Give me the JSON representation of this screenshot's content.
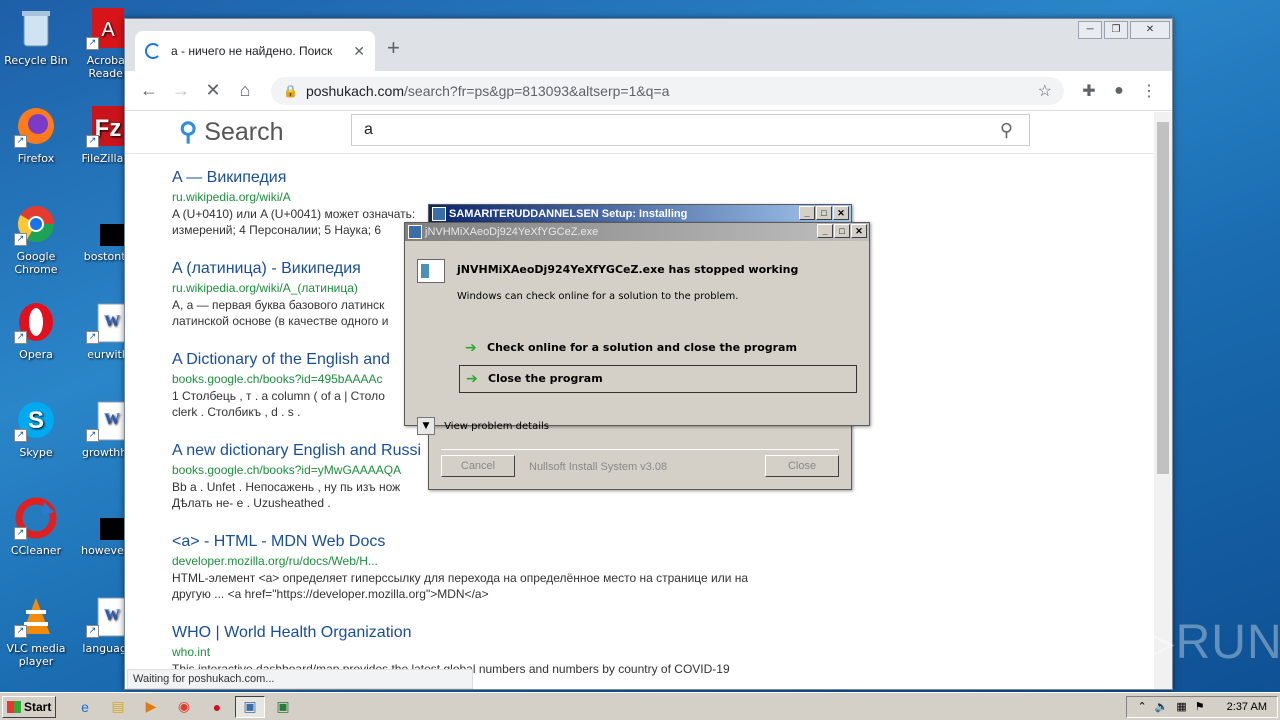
{
  "desktop_icons": [
    {
      "label": "Recycle Bin",
      "icon": "recycle-bin-icon"
    },
    {
      "label": "Acrobat Reader",
      "icon": "acrobat-icon"
    },
    {
      "label": "Firefox",
      "icon": "firefox-icon"
    },
    {
      "label": "FileZilla C",
      "icon": "filezilla-icon"
    },
    {
      "label": "Google Chrome",
      "icon": "chrome-icon"
    },
    {
      "label": "bostonto",
      "icon": "file-icon"
    },
    {
      "label": "Opera",
      "icon": "opera-icon"
    },
    {
      "label": "eurwith",
      "icon": "word-doc-icon"
    },
    {
      "label": "Skype",
      "icon": "skype-icon"
    },
    {
      "label": "growthho",
      "icon": "word-doc-icon"
    },
    {
      "label": "CCleaner",
      "icon": "ccleaner-icon"
    },
    {
      "label": "howevere",
      "icon": "file-icon"
    },
    {
      "label": "VLC media player",
      "icon": "vlc-icon"
    },
    {
      "label": "language",
      "icon": "word-doc-icon"
    }
  ],
  "browser": {
    "tab_title": "а - ничего не найдено. Поиск",
    "tab_close": "✕",
    "new_tab": "+",
    "url_host": "poshukach.com",
    "url_path": "/search?fr=ps&gp=813093&altserp=1&q=a",
    "window_controls": [
      "─",
      "❐",
      "✕"
    ],
    "status_text": "Waiting for poshukach.com..."
  },
  "site": {
    "logo": "Search",
    "query": "a"
  },
  "results": [
    {
      "title": "A — Википедия",
      "url": "ru.wikipedia.org/wiki/A",
      "snippet": "A (U+0410) или A (U+0041) может означать:",
      "snippet2": "измерений; 4 Персоналии; 5 Наука; 6"
    },
    {
      "title": "A (латиница) - Википедия",
      "url": "ru.wikipedia.org/wiki/A_(латиница)",
      "snippet": "A, a — первая буква базового латинск",
      "snippet2": "латинской основе (в качестве одного и"
    },
    {
      "title": "A Dictionary of the English and",
      "url": "books.google.ch/books?id=495bAAAAc",
      "snippet": "1 Столбець , т . a column ( of a | Столо",
      "snippet2": "clerk . Столбикъ , d . s ."
    },
    {
      "title": "A new dictionary English and Russi",
      "url": "books.google.ch/books?id=yMwGAAAAQA",
      "snippet": "Bb a . Unfet . Непосажень , ну пь изъ нож",
      "snippet2": "Дѣлать не- е . Uzusheathed ."
    },
    {
      "title": "<a> - HTML - MDN Web Docs",
      "url": "developer.mozilla.org/ru/docs/Web/H...",
      "snippet": "HTML-элемент <a> определяет гиперссылку для перехода на определённое место на странице или на",
      "snippet2": "другую ... <a href=\"https://developer.mozilla.org\">MDN</a>"
    },
    {
      "title": "WHO | World Health Organization",
      "url": "who.int",
      "snippet": "This interactive dashboard/map provides the latest global numbers and numbers by country of COVID-19",
      "snippet2": ""
    }
  ],
  "nsis": {
    "title": "SAMARITERUDDANNELSEN Setup: Installing",
    "cancel": "Cancel",
    "brand": "Nullsoft Install System v3.08",
    "close": "Close"
  },
  "werr": {
    "title": "jNVHMiXAeoDj924YeXfYGCeZ.exe",
    "heading": "jNVHMiXAeoDj924YeXfYGCeZ.exe has stopped working",
    "sub": "Windows can check online for a solution to the problem.",
    "option1": "Check online for a solution and close the program",
    "option2": "Close the program",
    "details": "View problem details"
  },
  "taskbar": {
    "start": "Start",
    "clock": "2:37 AM"
  },
  "watermark": "ANY▷RUN"
}
